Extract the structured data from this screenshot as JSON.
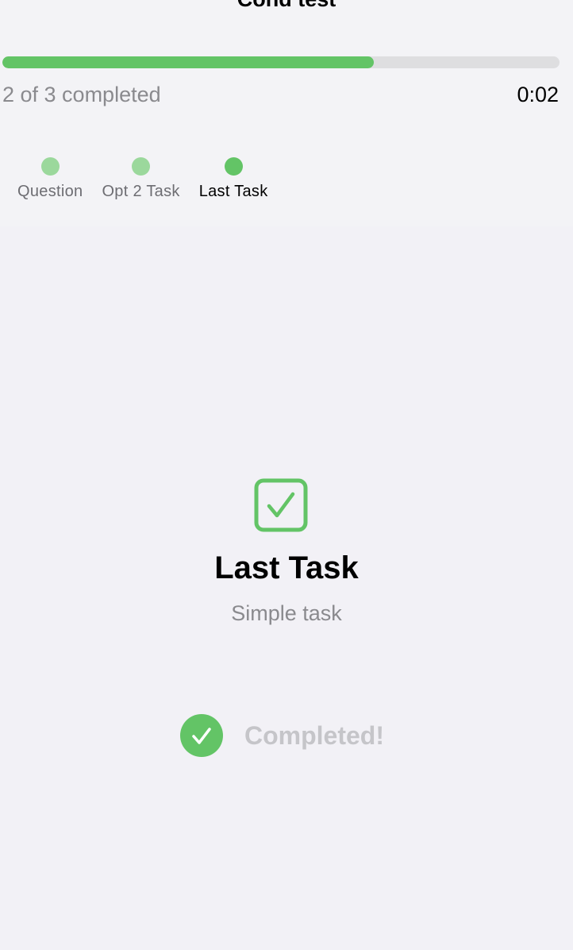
{
  "header": {
    "title": "Cond test",
    "progress": {
      "completed": 2,
      "total": 3,
      "fraction": 0.667,
      "label": "2 of 3 completed"
    },
    "timer": "0:02",
    "steps": [
      {
        "label": "Question",
        "state": "done"
      },
      {
        "label": "Opt 2 Task",
        "state": "done"
      },
      {
        "label": "Last Task",
        "state": "active"
      }
    ]
  },
  "task": {
    "icon": "checkbox-checked-icon",
    "title": "Last Task",
    "subtitle": "Simple task"
  },
  "status": {
    "icon": "checkmark-circle-icon",
    "label": "Completed!"
  },
  "colors": {
    "accent": "#63c466",
    "accent_light": "#9bd89c",
    "track": "#dedee0",
    "secondary_text": "#8a8a8e",
    "disabled_text": "#c5c5c9"
  }
}
